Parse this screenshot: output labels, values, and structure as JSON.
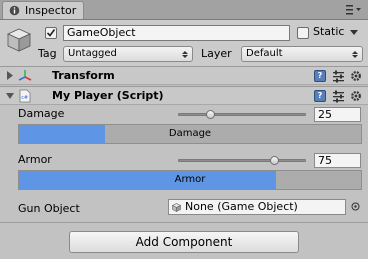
{
  "window": {
    "tab_label": "Inspector"
  },
  "header": {
    "active_checked": true,
    "object_name": "GameObject",
    "static_label": "Static",
    "tag_label": "Tag",
    "tag_value": "Untagged",
    "layer_label": "Layer",
    "layer_value": "Default"
  },
  "components": [
    {
      "title": "Transform",
      "expanded": false
    },
    {
      "title": "My Player (Script)",
      "expanded": true
    }
  ],
  "script": {
    "damage": {
      "label": "Damage",
      "value": "25",
      "slider_fraction": 0.25,
      "bar_label": "Damage",
      "bar_fill_fraction": 0.25
    },
    "armor": {
      "label": "Armor",
      "value": "75",
      "slider_fraction": 0.75,
      "bar_label": "Armor",
      "bar_fill_fraction": 0.75
    },
    "gun": {
      "label": "Gun Object",
      "value": "None (Game Object)"
    }
  },
  "footer": {
    "add_component_label": "Add Component"
  },
  "colors": {
    "bar_fill": "#5e95e5",
    "help_icon": "#5a7fb8",
    "background": "#c2c2c2"
  }
}
